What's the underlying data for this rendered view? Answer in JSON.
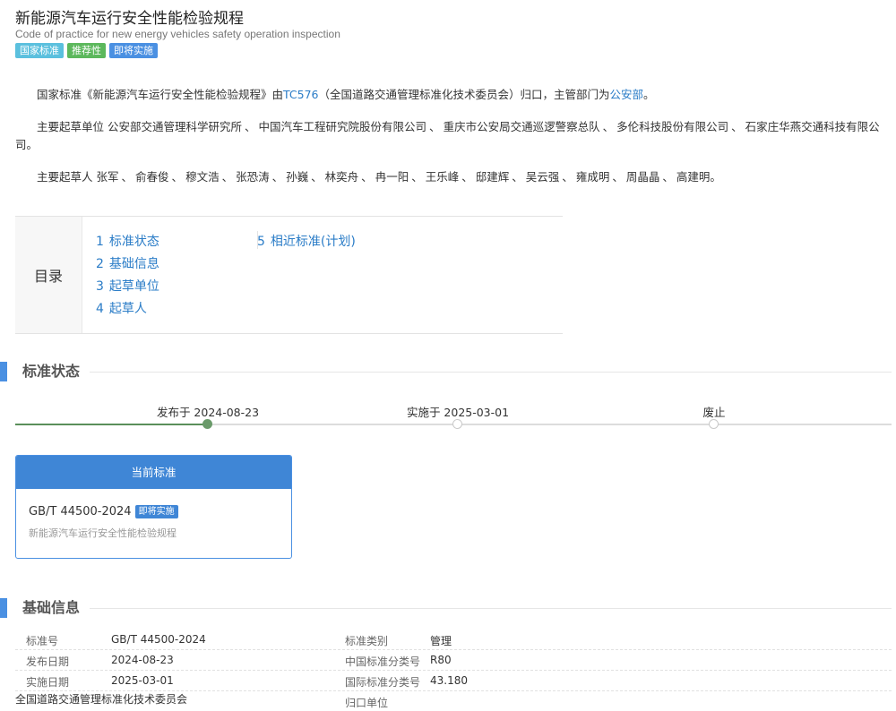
{
  "header": {
    "title": "新能源汽车运行安全性能检验规程",
    "subtitle": "Code of practice for new energy vehicles safety operation inspection",
    "badges": [
      {
        "label": "国家标准",
        "color": "#5bc0de"
      },
      {
        "label": "推荐性",
        "color": "#5cb85c"
      },
      {
        "label": "即将实施",
        "color": "#4a90e2"
      }
    ]
  },
  "summary": {
    "intro_prefix": "国家标准《新能源汽车运行安全性能检验规程》由",
    "tc_link": "TC576",
    "intro_middle": "（全国道路交通管理标准化技术委员会）归口，主管部门为",
    "dept_link": "公安部",
    "intro_suffix": "。",
    "units_label": "主要起草单位",
    "units": [
      "公安部交通管理科学研究所",
      "中国汽车工程研究院股份有限公司",
      "重庆市公安局交通巡逻警察总队",
      "多伦科技股份有限公司",
      "石家庄华燕交通科技有限公司"
    ],
    "units_end": "。",
    "people_label": "主要起草人",
    "people": [
      "张军",
      "俞春俊",
      "穆文浩",
      "张恐涛",
      "孙巍",
      "林奕舟",
      "冉一阳",
      "王乐峰",
      "邸建辉",
      "吴云强",
      "雍成明",
      "周晶晶",
      "高建明"
    ],
    "people_end": "。"
  },
  "toc": {
    "label": "目录",
    "items": [
      {
        "num": "1",
        "label": "标准状态"
      },
      {
        "num": "2",
        "label": "基础信息"
      },
      {
        "num": "3",
        "label": "起草单位"
      },
      {
        "num": "4",
        "label": "起草人"
      },
      {
        "num": "5",
        "label": "相近标准(计划)"
      }
    ]
  },
  "status_section": {
    "title": "标准状态",
    "stages": [
      {
        "label": "发布于 2024-08-23",
        "active": true
      },
      {
        "label": "实施于 2025-03-01",
        "active": false
      },
      {
        "label": "废止",
        "active": false
      }
    ],
    "card": {
      "header": "当前标准",
      "code": "GB/T 44500-2024",
      "badge": "即将实施",
      "name": "新能源汽车运行安全性能检验规程"
    }
  },
  "info_section": {
    "title": "基础信息",
    "rows": [
      {
        "k1": "标准号",
        "v1": "GB/T 44500-2024",
        "k2": "标准类别",
        "v2": "管理"
      },
      {
        "k1": "发布日期",
        "v1": "2024-08-23",
        "k2": "中国标准分类号",
        "v2": "R80"
      },
      {
        "k1": "实施日期",
        "v1": "2025-03-01",
        "k2": "国际标准分类号",
        "v2": "43.180"
      },
      {
        "k1": "",
        "v1": "",
        "k2": "归口单位",
        "v2": "全国道路交通管理标准化技术委员会"
      }
    ]
  }
}
